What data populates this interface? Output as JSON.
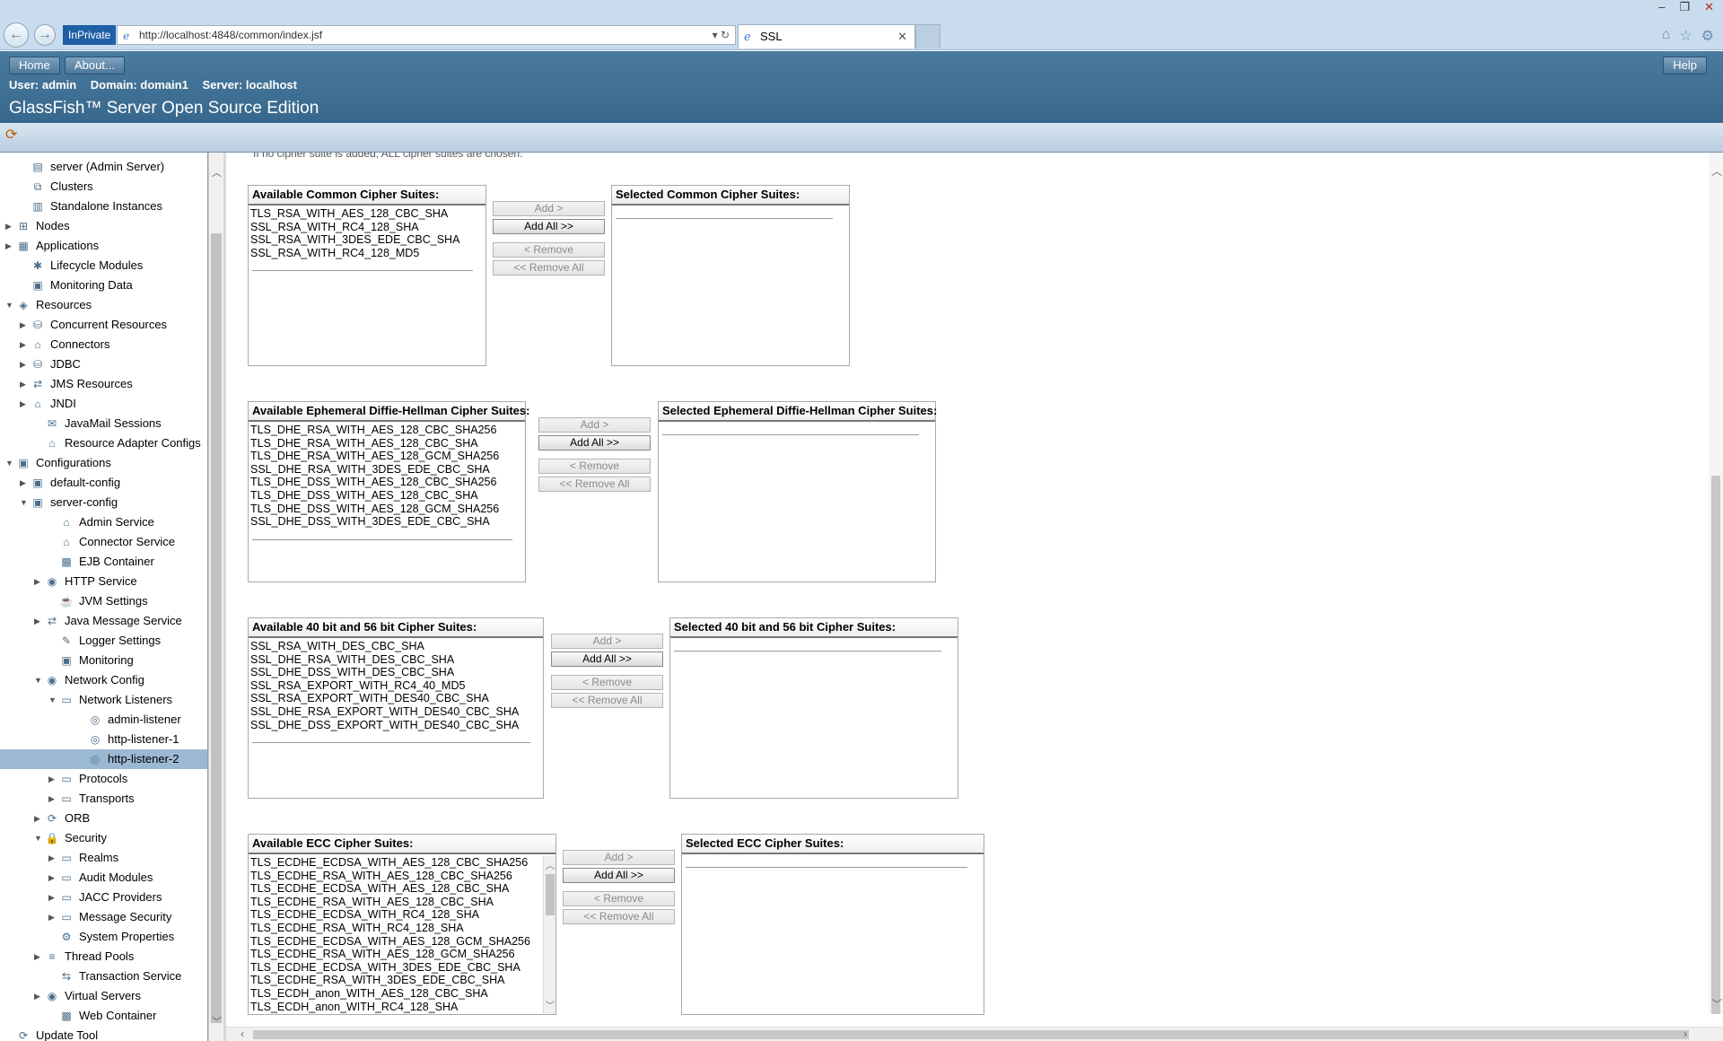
{
  "browser": {
    "inprivate": "InPrivate",
    "url": "http://localhost:4848/common/index.jsf",
    "tab_title": "SSL"
  },
  "header": {
    "home": "Home",
    "about": "About...",
    "help": "Help",
    "user": "User: admin",
    "domain": "Domain: domain1",
    "server": "Server: localhost",
    "product": "GlassFish™ Server Open Source Edition"
  },
  "tree": {
    "items": [
      {
        "label": "server (Admin Server)",
        "icon": "server-icon",
        "level": 1,
        "toggle": ""
      },
      {
        "label": "Clusters",
        "icon": "clusters-icon",
        "level": 1,
        "toggle": ""
      },
      {
        "label": "Standalone Instances",
        "icon": "instance-icon",
        "level": 1,
        "toggle": ""
      },
      {
        "label": "Nodes",
        "icon": "nodes-icon",
        "level": 0,
        "toggle": "▶"
      },
      {
        "label": "Applications",
        "icon": "applications-icon",
        "level": 0,
        "toggle": "▶"
      },
      {
        "label": "Lifecycle Modules",
        "icon": "lifecycle-icon",
        "level": 1,
        "toggle": ""
      },
      {
        "label": "Monitoring Data",
        "icon": "monitoring-icon",
        "level": 1,
        "toggle": ""
      },
      {
        "label": "Resources",
        "icon": "resources-icon",
        "level": 0,
        "toggle": "▼"
      },
      {
        "label": "Concurrent Resources",
        "icon": "database-icon",
        "level": 1,
        "toggle": "▶"
      },
      {
        "label": "Connectors",
        "icon": "connector-icon",
        "level": 1,
        "toggle": "▶"
      },
      {
        "label": "JDBC",
        "icon": "database-icon",
        "level": 1,
        "toggle": "▶"
      },
      {
        "label": "JMS Resources",
        "icon": "jms-icon",
        "level": 1,
        "toggle": "▶"
      },
      {
        "label": "JNDI",
        "icon": "jndi-icon",
        "level": 1,
        "toggle": "▶"
      },
      {
        "label": "JavaMail Sessions",
        "icon": "mail-icon",
        "level": 2,
        "toggle": ""
      },
      {
        "label": "Resource Adapter Configs",
        "icon": "adapter-icon",
        "level": 2,
        "toggle": ""
      },
      {
        "label": "Configurations",
        "icon": "config-icon",
        "level": 0,
        "toggle": "▼"
      },
      {
        "label": "default-config",
        "icon": "config-icon",
        "level": 1,
        "toggle": "▶"
      },
      {
        "label": "server-config",
        "icon": "config-icon",
        "level": 1,
        "toggle": "▼"
      },
      {
        "label": "Admin Service",
        "icon": "service-icon",
        "level": 3,
        "toggle": ""
      },
      {
        "label": "Connector Service",
        "icon": "service-icon",
        "level": 3,
        "toggle": ""
      },
      {
        "label": "EJB Container",
        "icon": "container-icon",
        "level": 3,
        "toggle": ""
      },
      {
        "label": "HTTP Service",
        "icon": "globe-icon",
        "level": 2,
        "toggle": "▶"
      },
      {
        "label": "JVM Settings",
        "icon": "jvm-icon",
        "level": 3,
        "toggle": ""
      },
      {
        "label": "Java Message Service",
        "icon": "jms-icon",
        "level": 2,
        "toggle": "▶"
      },
      {
        "label": "Logger Settings",
        "icon": "logger-icon",
        "level": 3,
        "toggle": ""
      },
      {
        "label": "Monitoring",
        "icon": "monitoring-icon",
        "level": 3,
        "toggle": ""
      },
      {
        "label": "Network Config",
        "icon": "globe-icon",
        "level": 2,
        "toggle": "▼"
      },
      {
        "label": "Network Listeners",
        "icon": "folder-icon",
        "level": 3,
        "toggle": "▼"
      },
      {
        "label": "admin-listener",
        "icon": "listener-icon",
        "level": 5,
        "toggle": ""
      },
      {
        "label": "http-listener-1",
        "icon": "listener-icon",
        "level": 5,
        "toggle": ""
      },
      {
        "label": "http-listener-2",
        "icon": "listener-icon",
        "level": 5,
        "toggle": "",
        "selected": true
      },
      {
        "label": "Protocols",
        "icon": "folder-icon",
        "level": 3,
        "toggle": "▶"
      },
      {
        "label": "Transports",
        "icon": "folder-icon",
        "level": 3,
        "toggle": "▶"
      },
      {
        "label": "ORB",
        "icon": "orb-icon",
        "level": 2,
        "toggle": "▶"
      },
      {
        "label": "Security",
        "icon": "lock-icon",
        "level": 2,
        "toggle": "▼"
      },
      {
        "label": "Realms",
        "icon": "folder-icon",
        "level": 3,
        "toggle": "▶"
      },
      {
        "label": "Audit Modules",
        "icon": "folder-icon",
        "level": 3,
        "toggle": "▶"
      },
      {
        "label": "JACC Providers",
        "icon": "folder-icon",
        "level": 3,
        "toggle": "▶"
      },
      {
        "label": "Message Security",
        "icon": "folder-icon",
        "level": 3,
        "toggle": "▶"
      },
      {
        "label": "System Properties",
        "icon": "properties-icon",
        "level": 3,
        "toggle": ""
      },
      {
        "label": "Thread Pools",
        "icon": "threadpool-icon",
        "level": 2,
        "toggle": "▶"
      },
      {
        "label": "Transaction Service",
        "icon": "transaction-icon",
        "level": 3,
        "toggle": ""
      },
      {
        "label": "Virtual Servers",
        "icon": "globe-icon",
        "level": 2,
        "toggle": "▶"
      },
      {
        "label": "Web Container",
        "icon": "container-icon",
        "level": 3,
        "toggle": ""
      },
      {
        "label": "Update Tool",
        "icon": "update-icon",
        "level": 0,
        "toggle": ""
      }
    ]
  },
  "main": {
    "cut_text": "If no cipher suite is added, ALL cipher suites are chosen.",
    "buttons": {
      "add": "Add >",
      "add_all": "Add All >>",
      "remove": "< Remove",
      "remove_all": "<< Remove All"
    },
    "groups": [
      {
        "available_title": "Available Common Cipher Suites:",
        "selected_title": "Selected Common Cipher Suites:",
        "available": [
          "TLS_RSA_WITH_AES_128_CBC_SHA",
          "SSL_RSA_WITH_RC4_128_SHA",
          "SSL_RSA_WITH_3DES_EDE_CBC_SHA",
          "SSL_RSA_WITH_RC4_128_MD5"
        ],
        "selected": []
      },
      {
        "available_title": "Available Ephemeral Diffie-Hellman Cipher Suites:",
        "selected_title": "Selected Ephemeral Diffie-Hellman Cipher Suites:",
        "available": [
          "TLS_DHE_RSA_WITH_AES_128_CBC_SHA256",
          "TLS_DHE_RSA_WITH_AES_128_CBC_SHA",
          "TLS_DHE_RSA_WITH_AES_128_GCM_SHA256",
          "SSL_DHE_RSA_WITH_3DES_EDE_CBC_SHA",
          "TLS_DHE_DSS_WITH_AES_128_CBC_SHA256",
          "TLS_DHE_DSS_WITH_AES_128_CBC_SHA",
          "TLS_DHE_DSS_WITH_AES_128_GCM_SHA256",
          "SSL_DHE_DSS_WITH_3DES_EDE_CBC_SHA"
        ],
        "selected": []
      },
      {
        "available_title": "Available 40 bit and 56 bit Cipher Suites:",
        "selected_title": "Selected 40 bit and 56 bit Cipher Suites:",
        "available": [
          "SSL_RSA_WITH_DES_CBC_SHA",
          "SSL_DHE_RSA_WITH_DES_CBC_SHA",
          "SSL_DHE_DSS_WITH_DES_CBC_SHA",
          "SSL_RSA_EXPORT_WITH_RC4_40_MD5",
          "SSL_RSA_EXPORT_WITH_DES40_CBC_SHA",
          "SSL_DHE_RSA_EXPORT_WITH_DES40_CBC_SHA",
          "SSL_DHE_DSS_EXPORT_WITH_DES40_CBC_SHA"
        ],
        "selected": []
      },
      {
        "available_title": "Available ECC Cipher Suites:",
        "selected_title": "Selected ECC Cipher Suites:",
        "available": [
          "TLS_ECDHE_ECDSA_WITH_AES_128_CBC_SHA256",
          "TLS_ECDHE_RSA_WITH_AES_128_CBC_SHA256",
          "TLS_ECDHE_ECDSA_WITH_AES_128_CBC_SHA",
          "TLS_ECDHE_RSA_WITH_AES_128_CBC_SHA",
          "TLS_ECDHE_ECDSA_WITH_RC4_128_SHA",
          "TLS_ECDHE_RSA_WITH_RC4_128_SHA",
          "TLS_ECDHE_ECDSA_WITH_AES_128_GCM_SHA256",
          "TLS_ECDHE_RSA_WITH_AES_128_GCM_SHA256",
          "TLS_ECDHE_ECDSA_WITH_3DES_EDE_CBC_SHA",
          "TLS_ECDHE_RSA_WITH_3DES_EDE_CBC_SHA",
          "TLS_ECDH_anon_WITH_AES_128_CBC_SHA",
          "TLS_ECDH_anon_WITH_RC4_128_SHA"
        ],
        "selected": []
      }
    ]
  },
  "colors": {
    "header_blue": "#2f6085",
    "selected_row": "#9cb9d3"
  }
}
